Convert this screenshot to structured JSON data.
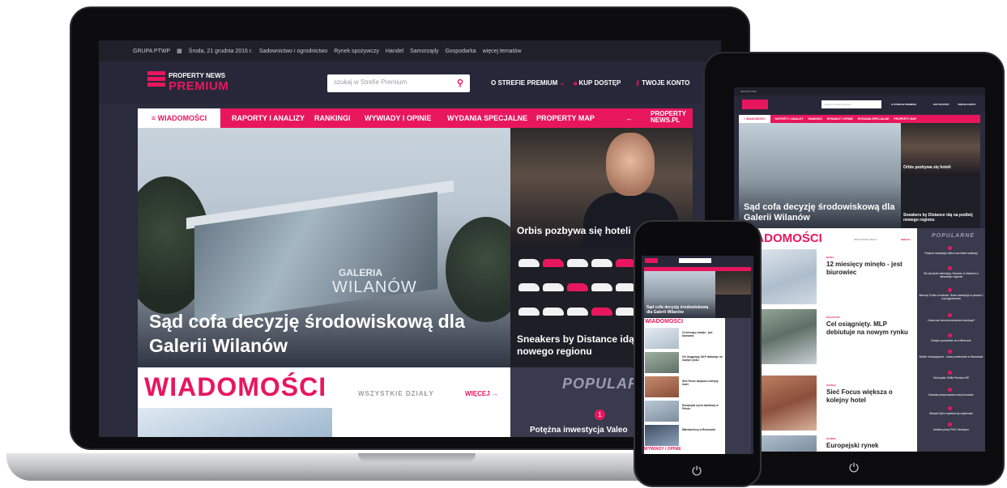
{
  "topbar": {
    "group": "GRUPA PTWP",
    "date": "Środa, 21 grudnia 2016 r.",
    "links": [
      "Sadownictwo i ogrodnictwo",
      "Rynek spożywczy",
      "Handel",
      "Samorządy",
      "Gospodarka",
      "więcej tematów"
    ]
  },
  "header": {
    "logo_top": "PROPERTY NEWS",
    "logo_bottom": "PREMIUM",
    "search_placeholder": "szukaj w Strefie Premium",
    "about": "O STREFIE PREMIUM",
    "buy": "KUP DOSTĘP",
    "account": "TWOJE KONTO"
  },
  "nav": {
    "active": "≡ WIADOMOŚCI",
    "items": [
      "RAPORTY I ANALIZY",
      "RANKINGI",
      "WYWIADY I OPINIE",
      "WYDANIA SPECJALNE",
      "PROPERTY MAP"
    ],
    "back_arrow": "←",
    "property_top": "PROPERTY",
    "property_bottom": "NEWS.PL"
  },
  "hero": {
    "sign_small": "GALERIA",
    "sign_big": "WILANÓW",
    "title": "Sąd cofa decyzję środowiskową dla Galerii Wilanów"
  },
  "side": {
    "first_caption": "Orbis pozbywa się hoteli",
    "second_caption": "Sneakers by Distance idą na podbój nowego regionu"
  },
  "news": {
    "title": "WIADOMOŚCI",
    "all_sections": "WSZYSTKIE DZIAŁY",
    "more": "WIĘCEJ →"
  },
  "popular": {
    "title": "POPULARNE",
    "first_number": "1",
    "first_item": "Potężna inwestycja Valeo"
  },
  "tablet": {
    "articles": [
      {
        "category": "BIURA",
        "title": "12 miesięcy minęło - jest biurowiec"
      },
      {
        "category": "MAGAZYNY",
        "title": "Cel osiągnięty. MLP debiutuje na nowym rynku"
      },
      {
        "category": "HOTELE",
        "title": "Sieć Focus większa o kolejny hotel"
      },
      {
        "category": "HANDEL",
        "title": "Europejski rynek"
      }
    ],
    "popular": [
      "Potężna inwestycja Valeo oraz błahe realizacji",
      "Tak się łamie stereotypy. Dworzec w Zawierciu z mieszanym regionie",
      "Biurowy Portal w budowie. Nowe inwestycje w planach i w przygotowaniu",
      "Czeka nas nieruchomościowa rewolucja?",
      "Kolejne pozwolenie na w Bieżronie",
      "Sieleki i futurystyczne - nowe przestrzenie w Warszawie",
      "Taki będzie Griffin Premium RE",
      "Skanska przeprowadza nowy biurowiec",
      "Warsaw Spire zapełnia się najemcami",
      "Ambitne plany PHN. Developer"
    ]
  },
  "phone": {
    "hero_title": "Sąd cofa decyzję środowiskową dla Galerii Wilanów",
    "news_title": "WIADOMOŚCI",
    "section_bottom": "WYWIADY I OPINIE",
    "articles": [
      "12 miesięcy minęło - jest biurowiec",
      "Cel osiągnięty. MLP debiutuje na nowym rynku",
      "Sieć Focus większa o kolejny hotel",
      "Europejski rynek handlowy w Polsce",
      "Mikrokurierzy w Rzeszowie"
    ]
  },
  "colors": {
    "accent": "#e8175d",
    "dark": "#2b2b3e",
    "header": "#272739"
  }
}
